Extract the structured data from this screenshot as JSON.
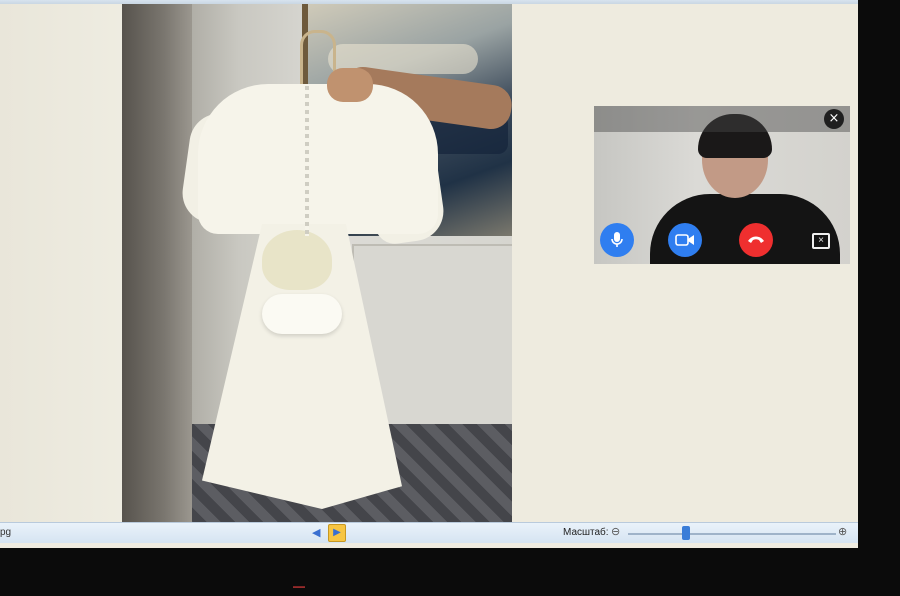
{
  "statusbar": {
    "filename_fragment": "pg",
    "scale_label": "Масштаб:",
    "zoom_level": 0.27
  },
  "video_call": {
    "close_icon": "close-icon",
    "mic_icon": "microphone-icon",
    "camera_icon": "video-camera-icon",
    "end_call_icon": "end-call-icon",
    "fullscreen_icon": "fullscreen-icon"
  },
  "colors": {
    "accent_blue": "#2f7ef0",
    "end_call_red": "#ef2f2f",
    "statusbar": "#dce8f4"
  }
}
